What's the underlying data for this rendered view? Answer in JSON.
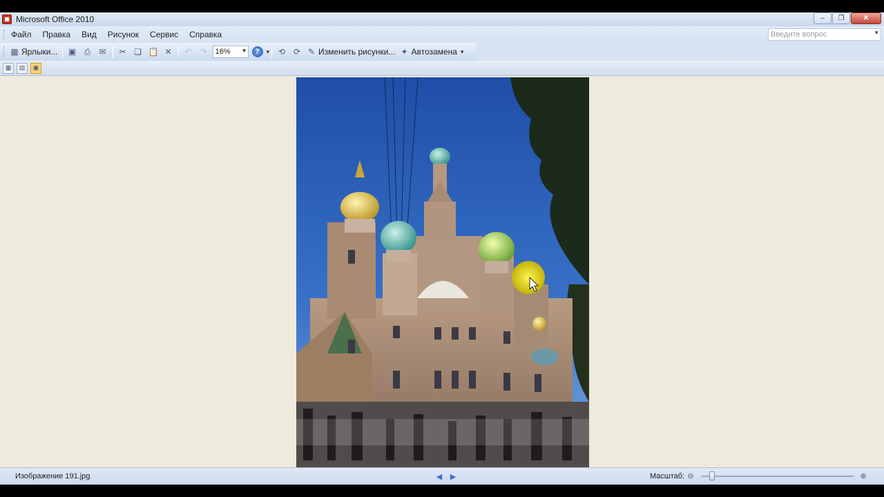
{
  "window": {
    "title": "Microsoft Office 2010"
  },
  "menu": {
    "items": [
      "Файл",
      "Правка",
      "Вид",
      "Рисунок",
      "Сервис",
      "Справка"
    ],
    "help_placeholder": "Введите вопрос"
  },
  "toolbar": {
    "shortcuts_label": "Ярлыки...",
    "zoom_value": "16%",
    "edit_pictures_label": "Изменить рисунки...",
    "autocorrect_label": "Автозамена"
  },
  "status": {
    "file_name": "Изображение 191.jpg",
    "zoom_label": "Масштаб:",
    "zoom_level_fraction": 0.07
  },
  "colors": {
    "accent": "#fbd47a",
    "canvas": "#eeeadd",
    "chrome": "#d5e2f2"
  }
}
